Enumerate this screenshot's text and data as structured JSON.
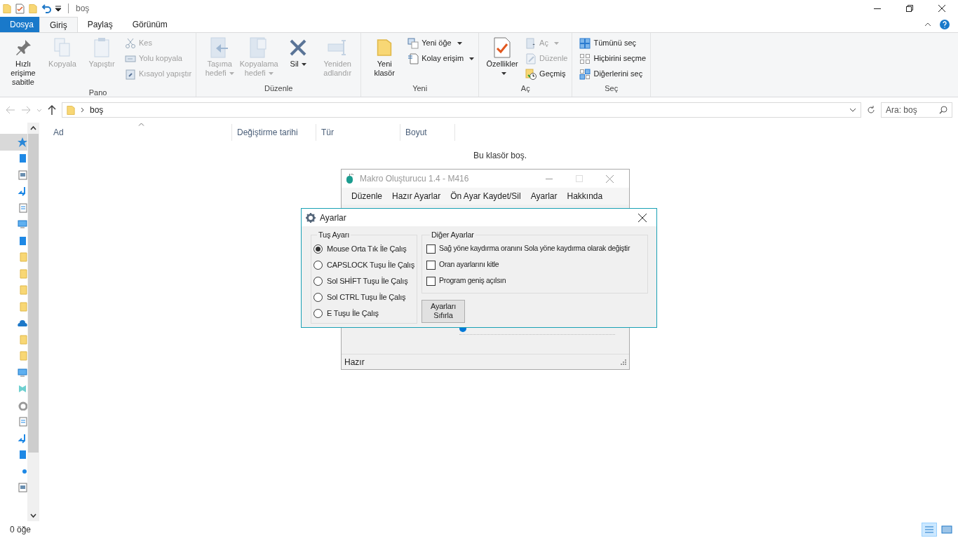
{
  "window": {
    "title": "boş"
  },
  "tabs": [
    {
      "label": "Dosya",
      "kind": "file",
      "selected": false
    },
    {
      "label": "Giriş",
      "kind": "tab",
      "selected": true
    },
    {
      "label": "Paylaş",
      "kind": "tab",
      "selected": false
    },
    {
      "label": "Görünüm",
      "kind": "tab",
      "selected": false
    }
  ],
  "ribbon": {
    "groups": [
      {
        "label": "Pano",
        "items": [
          {
            "kind": "large",
            "label": "Hızlı erişime sabitle",
            "disabled": false,
            "dropdown": false
          },
          {
            "kind": "large",
            "label": "Kopyala",
            "disabled": true,
            "dropdown": false
          },
          {
            "kind": "large",
            "label": "Yapıştır",
            "disabled": true,
            "dropdown": false
          },
          {
            "kind": "small",
            "label": "Kes",
            "disabled": true,
            "dropdown": false
          },
          {
            "kind": "small",
            "label": "Yolu kopyala",
            "disabled": true,
            "dropdown": false
          },
          {
            "kind": "small",
            "label": "Kısayol yapıştır",
            "disabled": true,
            "dropdown": false
          }
        ]
      },
      {
        "label": "Düzenle",
        "items": [
          {
            "kind": "large",
            "label": "Taşıma hedefi",
            "disabled": true,
            "dropdown": true
          },
          {
            "kind": "large",
            "label": "Kopyalama hedefi",
            "disabled": true,
            "dropdown": true
          },
          {
            "kind": "large",
            "label": "Sil",
            "disabled": false,
            "dropdown": true
          },
          {
            "kind": "large",
            "label": "Yeniden adlandır",
            "disabled": true,
            "dropdown": false
          }
        ]
      },
      {
        "label": "Yeni",
        "items": [
          {
            "kind": "large",
            "label": "Yeni klasör",
            "disabled": false,
            "dropdown": false
          },
          {
            "kind": "small",
            "label": "Yeni öğe",
            "disabled": false,
            "dropdown": true
          },
          {
            "kind": "small",
            "label": "Kolay erişim",
            "disabled": false,
            "dropdown": true
          }
        ]
      },
      {
        "label": "Aç",
        "items": [
          {
            "kind": "large",
            "label": "Özellikler",
            "disabled": false,
            "dropdown": true
          },
          {
            "kind": "small",
            "label": "Aç",
            "disabled": true,
            "dropdown": true
          },
          {
            "kind": "small",
            "label": "Düzenle",
            "disabled": true,
            "dropdown": false
          },
          {
            "kind": "small",
            "label": "Geçmiş",
            "disabled": false,
            "dropdown": false
          }
        ]
      },
      {
        "label": "Seç",
        "items": [
          {
            "kind": "small",
            "label": "Tümünü seç",
            "disabled": false,
            "dropdown": false
          },
          {
            "kind": "small",
            "label": "Hiçbirini seçme",
            "disabled": false,
            "dropdown": false
          },
          {
            "kind": "small",
            "label": "Diğerlerini seç",
            "disabled": false,
            "dropdown": false
          }
        ]
      }
    ]
  },
  "address": {
    "path": "boş",
    "search_placeholder": "Ara: boş"
  },
  "nav_pane": {
    "items": [
      {
        "kind": "star",
        "selected": true
      },
      {
        "kind": "device",
        "selected": false
      },
      {
        "kind": "picture",
        "selected": false
      },
      {
        "kind": "download",
        "selected": false
      },
      {
        "kind": "document",
        "selected": false
      },
      {
        "kind": "monitor",
        "selected": false
      },
      {
        "kind": "device",
        "selected": false
      },
      {
        "kind": "folder",
        "selected": false
      },
      {
        "kind": "folder",
        "selected": false
      },
      {
        "kind": "folder",
        "selected": false
      },
      {
        "kind": "folder",
        "selected": false
      },
      {
        "kind": "cloud",
        "selected": false
      },
      {
        "kind": "folder",
        "selected": false
      },
      {
        "kind": "folder",
        "selected": false
      },
      {
        "kind": "monitor",
        "selected": false
      },
      {
        "kind": "library",
        "selected": false
      },
      {
        "kind": "disc",
        "selected": false
      },
      {
        "kind": "document",
        "selected": false
      },
      {
        "kind": "download",
        "selected": false
      },
      {
        "kind": "device",
        "selected": false
      },
      {
        "kind": "dot",
        "selected": false
      },
      {
        "kind": "picture",
        "selected": false
      }
    ]
  },
  "table": {
    "columns": [
      "Ad",
      "Değiştirme tarihi",
      "Tür",
      "Boyut"
    ],
    "empty_message": "Bu klasör boş."
  },
  "status_bar": {
    "count": "0 öğe"
  },
  "macro_window": {
    "title": "Makro Oluşturucu 1.4 - M416",
    "menu": [
      "Düzenle",
      "Hazır Ayarlar",
      "Ön Ayar Kaydet/Sil",
      "Ayarlar",
      "Hakkında"
    ],
    "slider": {
      "level": 0
    },
    "status": "Hazır"
  },
  "dialog": {
    "title": "Ayarlar",
    "key_group": {
      "label": "Tuş Ayarı",
      "options": [
        {
          "label": "Mouse Orta Tık İle Çalış",
          "selected": true
        },
        {
          "label": "CAPSLOCK Tuşu İle Çalış",
          "selected": false
        },
        {
          "label": "Sol SHİFT Tuşu İle Çalış",
          "selected": false
        },
        {
          "label": "Sol CTRL Tuşu İle Çalış",
          "selected": false
        },
        {
          "label": "E Tuşu İle Çalış",
          "selected": false
        }
      ]
    },
    "other_group": {
      "label": "Diğer Ayarlar",
      "options": [
        {
          "label": "Sağ yöne kaydırma oranını Sola yöne kaydırma olarak değiştir",
          "checked": false
        },
        {
          "label": "Oran ayarlarını kitle",
          "checked": false
        },
        {
          "label": "Program geniş açılsın",
          "checked": false
        }
      ]
    },
    "reset_button": "Ayarları Sıfırla"
  }
}
